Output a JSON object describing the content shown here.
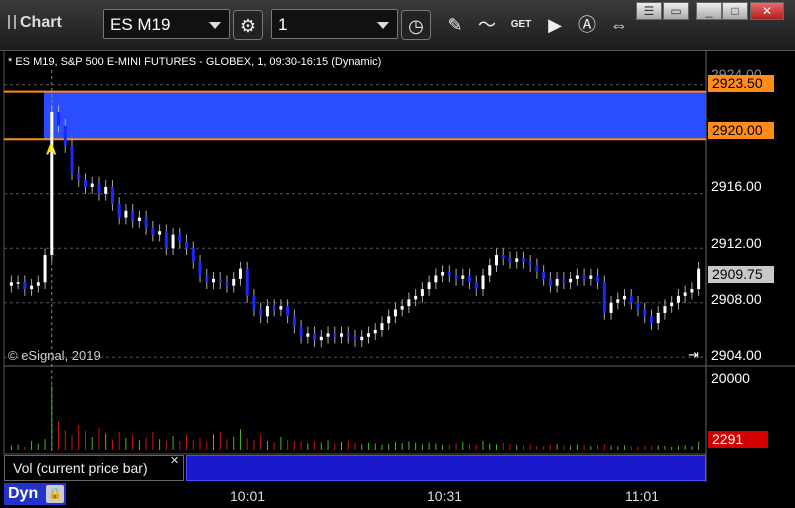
{
  "toolbar": {
    "title": "Chart",
    "symbol": "ES M19",
    "interval": "1",
    "get_label": "GET"
  },
  "chart_header": {
    "subtitle": "* ES M19, S&P 500 E-MINI FUTURES - GLOBEX, 1, 09:30-16:15 (Dynamic)"
  },
  "copyright": "© eSignal, 2019",
  "price_axis": {
    "ticks": [
      "2924.00",
      "2916.00",
      "2912.00",
      "2908.00",
      "2904.00"
    ],
    "last_price_tag": "2909.75",
    "band_top_tag": "2923.50",
    "band_bottom_tag": "2920.00"
  },
  "volume_axis": {
    "tick": "20000",
    "current_tag": "2291"
  },
  "volume_panel": {
    "label": "Vol (current price bar)"
  },
  "bottom": {
    "mode": "Dyn"
  },
  "annotation_marker": "A",
  "colors": {
    "band": "#2a4dff",
    "band_border": "#ff8c1a",
    "up_candle": "#ffffff",
    "down_candle": "#1a2aff",
    "vol_up": "#4cbb17",
    "vol_down": "#d01010",
    "last_tag": "#c8c8c8",
    "vol_tag": "#d00000"
  },
  "chart_data": {
    "type": "candlestick",
    "x_ticks": [
      "10:01",
      "10:31",
      "11:01"
    ],
    "ylim": [
      2903.5,
      2924.5
    ],
    "yticks": [
      2904,
      2908,
      2912,
      2916,
      2920,
      2924
    ],
    "highlight_band": [
      2920.0,
      2923.5
    ],
    "last_price": 2909.75,
    "closes": [
      2909.5,
      2909.5,
      2909.0,
      2909.25,
      2909.5,
      2911.5,
      2922.0,
      2921.0,
      2919.5,
      2917.5,
      2917.0,
      2916.5,
      2916.75,
      2916.0,
      2916.5,
      2915.25,
      2914.25,
      2914.75,
      2914.0,
      2914.25,
      2913.5,
      2913.0,
      2913.25,
      2912.0,
      2913.0,
      2912.5,
      2912.0,
      2911.0,
      2910.0,
      2909.5,
      2909.75,
      2909.5,
      2909.25,
      2909.75,
      2910.5,
      2908.5,
      2907.5,
      2907.0,
      2907.75,
      2907.5,
      2907.75,
      2907.0,
      2906.25,
      2905.5,
      2905.75,
      2905.25,
      2905.5,
      2905.75,
      2905.5,
      2905.75,
      2905.5,
      2905.25,
      2905.5,
      2905.75,
      2906.0,
      2906.5,
      2907.0,
      2907.5,
      2907.75,
      2908.25,
      2908.5,
      2909.0,
      2909.5,
      2910.0,
      2910.25,
      2910.0,
      2909.75,
      2910.0,
      2909.5,
      2909.0,
      2910.0,
      2910.75,
      2911.5,
      2911.25,
      2911.0,
      2911.25,
      2911.0,
      2910.75,
      2910.25,
      2909.75,
      2909.25,
      2909.75,
      2909.5,
      2909.75,
      2910.0,
      2909.75,
      2910.0,
      2909.5,
      2907.25,
      2908.0,
      2908.25,
      2908.5,
      2908.0,
      2907.5,
      2907.0,
      2906.5,
      2907.25,
      2907.75,
      2908.0,
      2908.5,
      2908.75,
      2909.0,
      2910.5
    ],
    "volumes": [
      1200,
      1500,
      900,
      2500,
      1800,
      3000,
      17800,
      8000,
      5500,
      4200,
      7000,
      5300,
      3600,
      6100,
      4600,
      2900,
      5000,
      3400,
      4200,
      2800,
      3500,
      5100,
      3000,
      2600,
      3900,
      2500,
      4200,
      2800,
      3400,
      2200,
      4400,
      5100,
      3000,
      3700,
      5800,
      3200,
      2900,
      4300,
      2500,
      2200,
      3600,
      2800,
      2400,
      2300,
      1900,
      2300,
      2100,
      2700,
      1800,
      2200,
      2600,
      1900,
      1600,
      2000,
      1800,
      1500,
      1700,
      2200,
      1900,
      2400,
      2000,
      1600,
      2100,
      1800,
      1400,
      1600,
      1900,
      2200,
      1700,
      1500,
      2500,
      1800,
      1600,
      2000,
      1700,
      1400,
      1300,
      1500,
      1200,
      1100,
      1400,
      1600,
      1300,
      1200,
      1500,
      1300,
      1100,
      1400,
      1700,
      1200,
      1000,
      1300,
      1100,
      900,
      1200,
      1000,
      1300,
      1100,
      900,
      1200,
      1300,
      1100,
      2291
    ]
  }
}
